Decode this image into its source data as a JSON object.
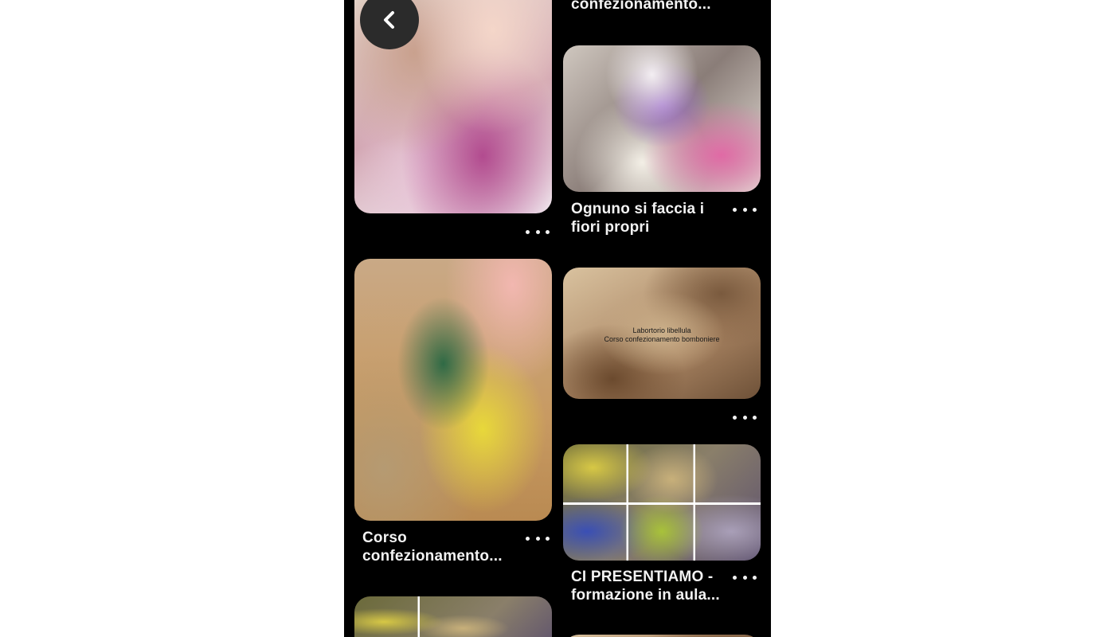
{
  "back_button": {
    "icon": "chevron-left-icon"
  },
  "pins": {
    "top_right_partial": {
      "title": "confezionamento..."
    },
    "pin_1": {
      "image": "laboratory-drawing-image"
    },
    "pin_2": {
      "title_line1": "Ognuno si faccia i",
      "title_line2": "fiori propri"
    },
    "pin_3": {
      "image_caption_line1": "Labortorio libellula",
      "image_caption_line2": "Corso confezionamento bomboniere"
    },
    "pin_4": {
      "title_line1": "Corso",
      "title_line2": "confezionamento..."
    },
    "pin_5": {
      "title_line1": "CI PRESENTIAMO -",
      "title_line2": "formazione in aula..."
    }
  },
  "more_icon": "more-dots-icon",
  "colors": {
    "background": "#000000",
    "text": "#f2f2f2",
    "back_button": "#2b2b2b"
  }
}
